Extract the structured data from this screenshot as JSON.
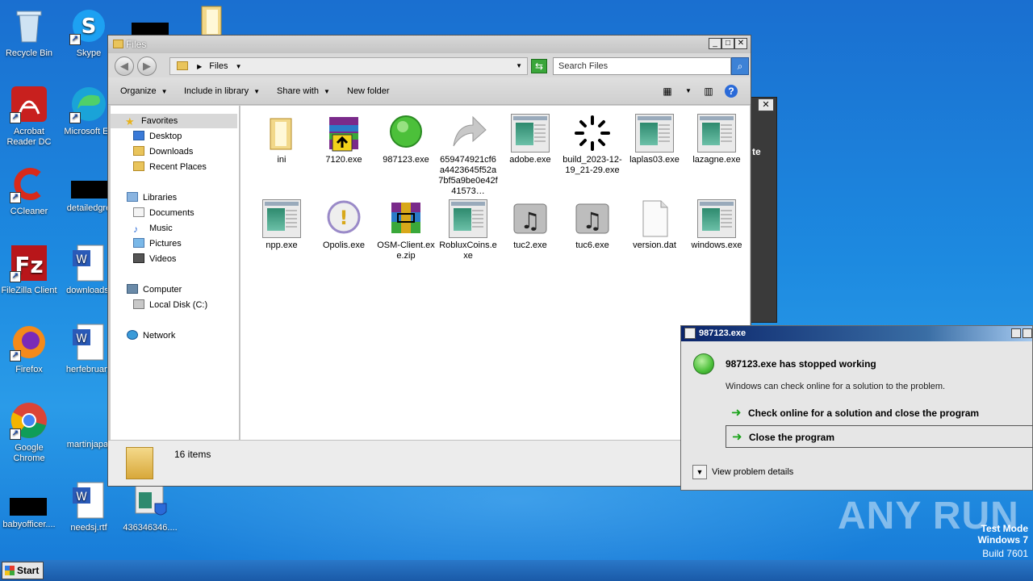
{
  "desktop": {
    "icons": [
      {
        "label": "Recycle Bin"
      },
      {
        "label": "Skype"
      },
      {
        "label": "Acrobat Reader DC"
      },
      {
        "label": "Microsoft Ed"
      },
      {
        "label": "CCleaner"
      },
      {
        "label": "detailedgre"
      },
      {
        "label": "FileZilla Client"
      },
      {
        "label": "downloads."
      },
      {
        "label": "Firefox"
      },
      {
        "label": "herfebruary"
      },
      {
        "label": "Google Chrome"
      },
      {
        "label": "martinjapa."
      },
      {
        "label": "babyofficer...."
      },
      {
        "label": "needsj.rtf"
      },
      {
        "label": "436346346...."
      }
    ]
  },
  "explorer": {
    "title": "Files",
    "address": "Files",
    "search_placeholder": "Search Files",
    "toolbar": {
      "organize": "Organize",
      "include_in_library": "Include in library",
      "share_with": "Share with",
      "new_folder": "New folder"
    },
    "nav": {
      "favorites": "Favorites",
      "desktop": "Desktop",
      "downloads": "Downloads",
      "recent_places": "Recent Places",
      "libraries": "Libraries",
      "documents": "Documents",
      "music": "Music",
      "pictures": "Pictures",
      "videos": "Videos",
      "computer": "Computer",
      "local_disk": "Local Disk (C:)",
      "network": "Network"
    },
    "files": [
      {
        "name": "ini",
        "icon": "folder-icon"
      },
      {
        "name": "7120.exe",
        "icon": "winrar-sfx-icon"
      },
      {
        "name": "987123.exe",
        "icon": "green-circle-icon"
      },
      {
        "name": "659474921cf6a4423645f52a7bf5a9be0e42f41573…",
        "icon": "shortcut-arrow-icon"
      },
      {
        "name": "adobe.exe",
        "icon": "exe-icon"
      },
      {
        "name": "build_2023-12-19_21-29.exe",
        "icon": "loading-spinner-icon"
      },
      {
        "name": "laplas03.exe",
        "icon": "exe-icon"
      },
      {
        "name": "lazagne.exe",
        "icon": "exe-icon"
      },
      {
        "name": "npp.exe",
        "icon": "exe-icon"
      },
      {
        "name": "Opolis.exe",
        "icon": "warning-icon"
      },
      {
        "name": "OSM-Client.exe.zip",
        "icon": "winrar-archive-icon"
      },
      {
        "name": "RobluxCoins.exe",
        "icon": "exe-icon"
      },
      {
        "name": "tuc2.exe",
        "icon": "music-file-icon"
      },
      {
        "name": "tuc6.exe",
        "icon": "music-file-icon"
      },
      {
        "name": "version.dat",
        "icon": "blank-file-icon"
      },
      {
        "name": "windows.exe",
        "icon": "exe-icon"
      }
    ],
    "status": "16 items"
  },
  "background_window": {
    "text": "te"
  },
  "dialog": {
    "title": "987123.exe",
    "heading": "987123.exe has stopped working",
    "subtext": "Windows can check online for a solution to the problem.",
    "option_check": "Check online for a solution and close the program",
    "option_close": "Close the program",
    "details": "View problem details"
  },
  "watermark": "ANY RUN",
  "system": {
    "mode": "Test Mode",
    "os": "Windows 7",
    "build": "Build 7601"
  },
  "taskbar": {
    "start": "Start"
  },
  "colors": {
    "desktop_blue": "#1d8ae0",
    "accent_green": "#1aa31a",
    "dialog_title": "#0a246a"
  }
}
